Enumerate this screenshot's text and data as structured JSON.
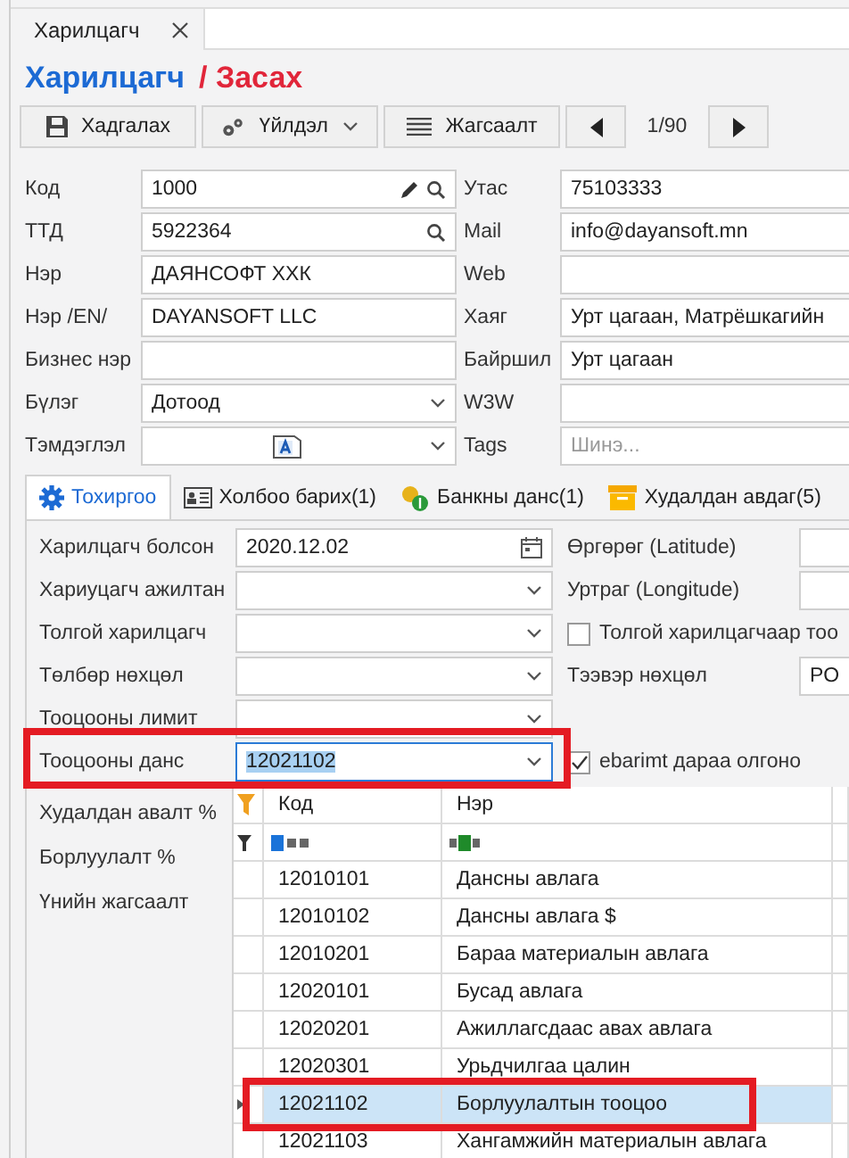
{
  "doc_tab": {
    "label": "Харилцагч"
  },
  "title": {
    "entity": "Харилцагч",
    "action": "/ Засах"
  },
  "toolbar": {
    "buttons": [
      {
        "kind": "save",
        "label": "Хадгалах"
      },
      {
        "kind": "actions",
        "label": "Үйлдэл"
      },
      {
        "kind": "list",
        "label": "Жагсаалт"
      }
    ],
    "pager": "1/90"
  },
  "form_rows": [
    {
      "left": {
        "label": "Код",
        "kind": "code",
        "value": "1000"
      },
      "right": {
        "label": "Утас",
        "kind": "text",
        "value": "75103333"
      }
    },
    {
      "left": {
        "label": "ТТД",
        "kind": "search",
        "value": "5922364"
      },
      "right": {
        "label": "Mail",
        "kind": "text",
        "value": "info@dayansoft.mn"
      }
    },
    {
      "left": {
        "label": "Нэр",
        "kind": "text",
        "value": "ДАЯНСОФТ ХХК"
      },
      "right": {
        "label": "Web",
        "kind": "text"
      }
    },
    {
      "left": {
        "label": "Нэр /EN/",
        "kind": "text",
        "value": "DAYANSOFT LLC"
      },
      "right": {
        "label": "Хаяг",
        "kind": "text",
        "value": "Урт цагаан, Матрёшкагийн"
      }
    },
    {
      "left": {
        "label": "Бизнес нэр",
        "kind": "text"
      },
      "right": {
        "label": "Байршил",
        "kind": "text",
        "value": "Урт цагаан"
      }
    },
    {
      "left": {
        "label": "Бүлэг",
        "kind": "select",
        "value": "Дотоод"
      },
      "right": {
        "label": "W3W",
        "kind": "text"
      }
    },
    {
      "left": {
        "label": "Тэмдэглэл",
        "kind": "note"
      },
      "right": {
        "label": "Tags",
        "kind": "text",
        "placeholder": "Шинэ..."
      }
    }
  ],
  "tabs": [
    {
      "kind": "gear",
      "label": "Тохиргоо",
      "selected": true
    },
    {
      "kind": "card",
      "label": "Холбоо барих(1)",
      "selected": false
    },
    {
      "kind": "coins",
      "label": "Банкны данс(1)",
      "selected": false
    },
    {
      "kind": "box",
      "label": "Худалдан авдаг(5)",
      "selected": false
    }
  ],
  "settings_rows": [
    {
      "left": {
        "label": "Харилцагч болсон",
        "kind": "date",
        "value": "2020.12.02"
      },
      "right": {
        "kind": "field",
        "label": "Өргөрөг (Latitude)"
      }
    },
    {
      "left": {
        "label": "Хариуцагч ажилтан",
        "kind": "select"
      },
      "right": {
        "kind": "field",
        "label": "Уртраг (Longitude)"
      }
    },
    {
      "left": {
        "label": "Толгой харилцагч",
        "kind": "select"
      },
      "right": {
        "kind": "checkbox",
        "label": "Толгой харилцагчаар тоо",
        "checked": false
      }
    },
    {
      "left": {
        "label": "Төлбөр нөхцөл",
        "kind": "select"
      },
      "right": {
        "kind": "field",
        "label": "Тээвэр нөхцөл",
        "value": "PO"
      }
    },
    {
      "left": {
        "label": "Тооцооны лимит",
        "kind": "select"
      }
    },
    {
      "left": {
        "label": "Тооцооны данс",
        "kind": "select",
        "value": "12021102",
        "focused": true,
        "highlight": true
      },
      "right": {
        "kind": "checkbox",
        "label": "ebarimt дараа олгоно",
        "checked": true
      }
    }
  ],
  "side_labels": [
    "Худалдан авалт %",
    "Борлуулалт %",
    "Үнийн жагсаалт"
  ],
  "grid": {
    "columns": [
      "Код",
      "Нэр"
    ],
    "rows": [
      {
        "code": "12010101",
        "name": "Дансны авлага",
        "selected": false,
        "highlight": false
      },
      {
        "code": "12010102",
        "name": "Дансны авлага $",
        "selected": false,
        "highlight": false
      },
      {
        "code": "12010201",
        "name": "Бараа материалын авлага",
        "selected": false,
        "highlight": false
      },
      {
        "code": "12020101",
        "name": "Бусад авлага",
        "selected": false,
        "highlight": false
      },
      {
        "code": "12020201",
        "name": "Ажиллагсдаас авах авлага",
        "selected": false,
        "highlight": false
      },
      {
        "code": "12020301",
        "name": "Урьдчилгаа цалин",
        "selected": false,
        "highlight": false
      },
      {
        "code": "12021102",
        "name": "Борлуулалтын тооцоо",
        "selected": true,
        "highlight": true
      },
      {
        "code": "12021103",
        "name": "Хангамжийн материалын авлага",
        "selected": false,
        "highlight": false
      }
    ]
  }
}
